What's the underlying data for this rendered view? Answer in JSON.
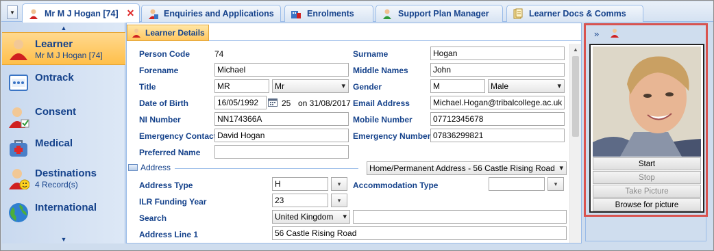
{
  "tabs": [
    {
      "label": "Mr M J Hogan [74]",
      "active": true,
      "icon": "person-icon",
      "closable": true
    },
    {
      "label": "Enquiries and Applications",
      "icon": "person-icon"
    },
    {
      "label": "Enrolments",
      "icon": "building-icon"
    },
    {
      "label": "Support Plan Manager",
      "icon": "person-icon"
    },
    {
      "label": "Learner Docs & Comms",
      "icon": "documents-icon"
    }
  ],
  "close_glyph": "✕",
  "dropdown_glyph": "▼",
  "nav": {
    "items": [
      {
        "label": "Learner",
        "sub": "Mr M J Hogan [74]",
        "icon": "person-icon",
        "active": true
      },
      {
        "label": "Ontrack",
        "sub": "",
        "icon": "ontrack-icon"
      },
      {
        "label": "Consent",
        "sub": "",
        "icon": "consent-icon"
      },
      {
        "label": "Medical",
        "sub": "",
        "icon": "medical-bag-icon"
      },
      {
        "label": "Destinations",
        "sub": "4 Record(s)",
        "icon": "destinations-icon"
      },
      {
        "label": "International",
        "sub": "",
        "icon": "globe-icon"
      }
    ]
  },
  "section": {
    "title": "Learner Details"
  },
  "fields": {
    "person_code_label": "Person Code",
    "person_code": "74",
    "surname_label": "Surname",
    "surname": "Hogan",
    "forename_label": "Forename",
    "forename": "Michael",
    "middle_names_label": "Middle Names",
    "middle_names": "John",
    "title_label": "Title",
    "title_code": "MR",
    "title_select": "Mr",
    "gender_label": "Gender",
    "gender_code": "M",
    "gender_select": "Male",
    "dob_label": "Date of Birth",
    "dob": "16/05/1992",
    "age": "25",
    "age_on": "on 31/08/2017",
    "email_label": "Email Address",
    "email": "Michael.Hogan@tribalcollege.ac.uk",
    "ni_label": "NI Number",
    "ni": "NN174366A",
    "mobile_label": "Mobile Number",
    "mobile": "07712345678",
    "emergency_contact_label": "Emergency Contact",
    "emergency_contact": "David Hogan",
    "emergency_number_label": "Emergency Number",
    "emergency_number": "07836299821",
    "preferred_name_label": "Preferred Name",
    "preferred_name": ""
  },
  "address": {
    "heading": "Address",
    "selector": "Home/Permanent Address - 56 Castle Rising Road",
    "type_label": "Address Type",
    "type": "H",
    "accommodation_label": "Accommodation Type",
    "accommodation": "",
    "ilr_label": "ILR Funding Year",
    "ilr": "23",
    "search_label": "Search",
    "search_country": "United Kingdom",
    "search_value": "",
    "line1_label": "Address Line 1",
    "line1": "56 Castle Rising Road"
  },
  "photo_panel": {
    "expand_glyph": "»",
    "buttons": {
      "start": "Start",
      "stop": "Stop",
      "take": "Take Picture",
      "browse": "Browse for picture"
    }
  },
  "colors": {
    "highlight": "#d9534f",
    "active_nav": "#ffbf4a",
    "label": "#15428b"
  }
}
